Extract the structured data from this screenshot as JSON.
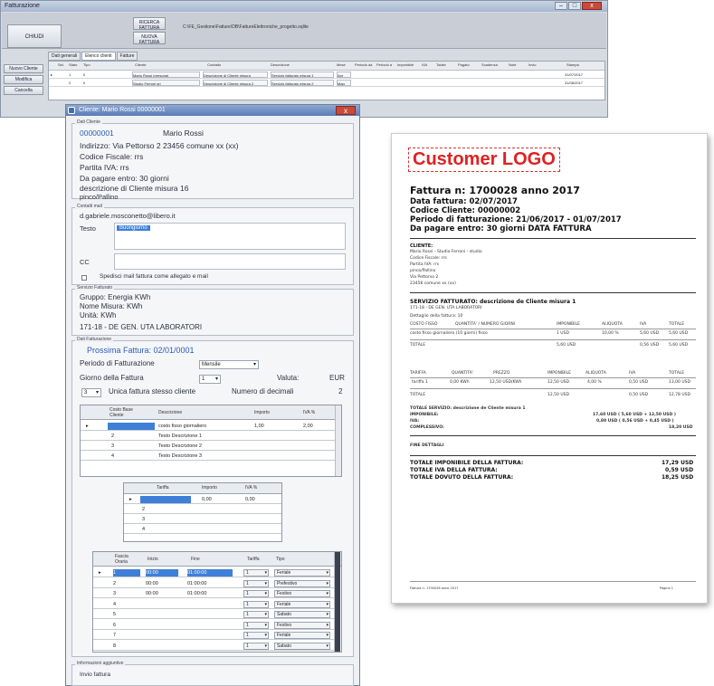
{
  "main": {
    "title": "Fatturazione",
    "close_label": "x",
    "btn_chiudi": "CHIUDI",
    "btn_ricerca": "RICERCA FATTURA",
    "btn_nuova": "NUOVA FATTURA",
    "db_path": "C:\\FE_Gestione\\Fatture\\DB\\FattureElettroniche_progetto.sqlite",
    "tabs": [
      "Dati generali",
      "Elenco clienti",
      "Fatture"
    ],
    "side_buttons": [
      "Nuovo Cliente",
      "Modifica",
      "Cancella"
    ],
    "grid_headers": [
      "Sel.",
      "Stato",
      "Tipo",
      "Cliente",
      "Contatto",
      "Descrizione",
      "Mese",
      "Periodo da",
      "Periodo a",
      "Imponibile",
      "IVA",
      "Totale",
      "Pagato",
      "Scadenza",
      "Note",
      "Invio",
      "Stampa"
    ],
    "rows": [
      {
        "marker": "▸",
        "n": "1",
        "k": "0",
        "cliente": "Mario Rossi (persona)",
        "contatto": "Descrizione di Cliente misura",
        "descr": "Servizio fatturato misura 1",
        "mese": "Apr",
        "scad": "31/07/2017"
      },
      {
        "marker": "",
        "n": "2",
        "k": "0",
        "cliente": "Studio Ferroni srl",
        "contatto": "Descrizione di Cliente misura 2",
        "descr": "Servizio fatturato misura 2",
        "mese": "Mag",
        "scad": "31/08/2017"
      }
    ]
  },
  "cliente": {
    "title": "Cliente: Mario Rossi 00000001",
    "close_label": "x",
    "dati_label": "Dati Cliente",
    "codice": "00000001",
    "nome": "Mario Rossi",
    "indirizzo": "Indirizzo: Via Pettorso 2 23456 comune xx (xx)",
    "cf": "Codice Fiscale: rrs",
    "piva": "Partita IVA: rrs",
    "pagamento": "Da pagare entro: 30 giorni",
    "descrizione": "descrizione di Cliente misura 16",
    "profilo": "pinco/Pallino",
    "contatti_label": "Contatti mail",
    "email": "d.gabriele.mosconetto@libero.it",
    "testo_label": "Testo",
    "testo_value": "Buongiorno",
    "cc_label": "CC",
    "spedisci": "Spedisci mail fattura come allegato e mail",
    "servizio_label": "Servizio Fatturato",
    "gruppo": "Gruppo: Energia KWh",
    "nome_misura": "Nome Misura: KWh",
    "unita": "Unità: KWh",
    "servizio_code": "171-18 - DE GEN. UTA LABORATORI",
    "fatturazione_label": "Dati Fatturazione",
    "prossima": "Prossima Fattura: 02/01/0001",
    "periodo_label": "Periodo di Fatturazione",
    "periodo_value": "Mensile",
    "giorno_label": "Giorno della Fattura",
    "giorno_value": "1",
    "valuta_label": "Valuta:",
    "valuta_value": "EUR",
    "unica_value": "3",
    "unica_label": "Unica fattura stesso cliente",
    "decimali_label": "Numero di decimali",
    "decimali_value": "2",
    "g1_headers": [
      "Costo Base Cliente",
      "Descrizione",
      "Importo",
      "IVA %"
    ],
    "g1_rows": [
      {
        "n": "",
        "descr": "costo fisso giornaliero",
        "importo": "1,00",
        "iva": "2,00"
      },
      {
        "n": "2",
        "descr": "Testo Descrizione 1",
        "importo": "",
        "iva": ""
      },
      {
        "n": "3",
        "descr": "Testo Descrizione 2",
        "importo": "",
        "iva": ""
      },
      {
        "n": "4",
        "descr": "Testo Descrizione 3",
        "importo": "",
        "iva": ""
      }
    ],
    "g2_headers": [
      "Tariffa",
      "Importo",
      "IVA %"
    ],
    "g2_rows": [
      {
        "n": "",
        "a": "",
        "b": "0,00",
        "c": "0,00"
      },
      {
        "n": "2",
        "a": "",
        "b": "",
        "c": ""
      },
      {
        "n": "3",
        "a": "",
        "b": "",
        "c": ""
      },
      {
        "n": "4",
        "a": "",
        "b": "",
        "c": ""
      }
    ],
    "g3_headers": [
      "Fascia Oraria",
      "Inizio",
      "Fine",
      "Tariffa",
      "Tipo"
    ],
    "g3_rows": [
      {
        "n": "1",
        "a": "00:00",
        "b": "01:00:00",
        "c": "1",
        "t": "Feriale"
      },
      {
        "n": "2",
        "a": "00:00",
        "b": "01:00:00",
        "c": "1",
        "t": "Prefestivo"
      },
      {
        "n": "3",
        "a": "00:00",
        "b": "01:00:00",
        "c": "1",
        "t": "Festivo"
      },
      {
        "n": "4",
        "a": "",
        "b": "",
        "c": "1",
        "t": "Feriale"
      },
      {
        "n": "5",
        "a": "",
        "b": "",
        "c": "1",
        "t": "Sabato"
      },
      {
        "n": "6",
        "a": "",
        "b": "",
        "c": "1",
        "t": "Festivo"
      },
      {
        "n": "7",
        "a": "",
        "b": "",
        "c": "1",
        "t": "Feriale"
      },
      {
        "n": "8",
        "a": "",
        "b": "",
        "c": "1",
        "t": "Sabato"
      }
    ],
    "info_label": "Informazioni aggiuntive",
    "info_value": "Invio fattura"
  },
  "invoice": {
    "logo": "Customer LOGO",
    "fattura_n": "Fattura n: 1700028 anno 2017",
    "data": "Data fattura: 02/07/2017",
    "codice": "Codice Cliente: 00000002",
    "periodo": "Periodo di fatturazione: 21/06/2017 - 01/07/2017",
    "pagare": "Da pagare entro: 30 giorni DATA FATTURA",
    "cliente_h": "CLIENTE:",
    "cliente_lines": [
      "Mario Rossi - Studio Ferroni - studio",
      "Codice Fiscale: rrs",
      "Partita IVA: rrs",
      "pinco/Pallino",
      "Via Pettorso 2",
      "23456 comune xx (xx)"
    ],
    "servizio_h": "SERVIZIO FATTURATO: descrizione de Cliente misura 1",
    "servizio_sub": "171-18 - DE GEN. UTA LABORATORI",
    "dettaglio": "Dettaglio della fattura: 10",
    "t1_headers": [
      "COSTO FISSO",
      "QUANTITA' / NUMERO GIORNI",
      "IMPONIBILE",
      "ALIQUOTA",
      "IVA",
      "TOTALE"
    ],
    "t1_row": [
      "costo fisso giornaliero (10 giorni) fisso",
      "1 USD",
      "10,00 %",
      "5,60 USD",
      "0,56 USD",
      "5,60 USD"
    ],
    "t1_total": [
      "TOTALE",
      "5,60 USD",
      "0,56 USD",
      "5,60 USD"
    ],
    "t2_headers": [
      "TARIFFA",
      "QUANTITA'",
      "PREZZO",
      "IMPONIBILE",
      "ALIQUOTA",
      "IVA",
      "TOTALE"
    ],
    "t2_row": [
      "tariffa 1",
      "0,00 KWh",
      "12,50 USD/KWh",
      "12,50 USD",
      "4,00 %",
      "0,50 USD",
      "13,00 USD"
    ],
    "t2_total": [
      "TOTALE",
      "12,50 USD",
      "0,50 USD",
      "12,78 USD"
    ],
    "riep_lines": [
      "TOTALE SERVIZIO: descrizione de Cliente misura 1",
      "IMPONIBILE:",
      "IVA:",
      "COMPLESSIVO:"
    ],
    "riep_vals": [
      "17,60 USD ( 5,60 USD + 12,50 USD )",
      "0,80 USD ( 0,56 USD + 0,45 USD )",
      "18,20 USD"
    ],
    "fine": "FINE DETTAGLI",
    "tot_lines": [
      "TOTALE IMPONIBILE DELLA FATTURA:",
      "TOTALE IVA DELLA FATTURA:",
      "TOTALE DOVUTO DELLA FATTURA:"
    ],
    "tot_vals": [
      "17,29 USD",
      "0,59 USD",
      "18,25 USD"
    ],
    "footer_left": "Fattura n: 1700028 anno 2017",
    "footer_right": "Pagina 1"
  }
}
